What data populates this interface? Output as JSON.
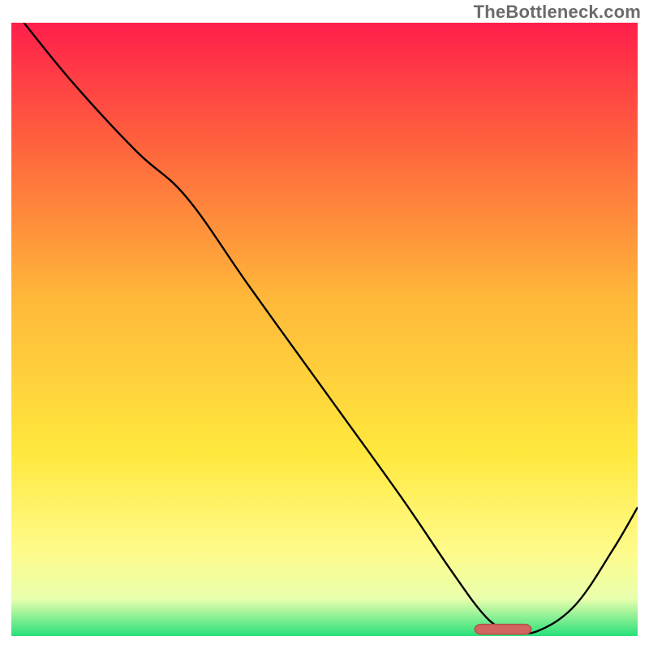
{
  "watermark": "TheBottleneck.com",
  "colors": {
    "gradient_top": "#ff1f4b",
    "gradient_mid1": "#ff6a3c",
    "gradient_mid2": "#ffb83a",
    "gradient_mid3": "#ffe83d",
    "gradient_mid4": "#fffb8a",
    "gradient_mid5": "#e8ffad",
    "gradient_bottom": "#28e07a",
    "line": "#000000",
    "marker_fill": "#d2655f",
    "marker_stroke": "#b84f49"
  },
  "chart_data": {
    "type": "line",
    "title": "",
    "xlabel": "",
    "ylabel": "",
    "xlim": [
      0,
      100
    ],
    "ylim": [
      0,
      100
    ],
    "series": [
      {
        "name": "bottleneck-curve",
        "x": [
          2,
          10,
          20,
          28,
          38,
          50,
          62,
          70,
          75,
          78,
          80,
          84,
          90,
          96,
          100
        ],
        "y": [
          100,
          90,
          79,
          71.5,
          57,
          40,
          23,
          11,
          4,
          1.3,
          0.8,
          0.8,
          5,
          14,
          21
        ]
      }
    ],
    "marker": {
      "name": "optimal-range",
      "x_start": 74,
      "x_end": 83,
      "y": 1.1,
      "height": 1.6,
      "rx": 1.0
    }
  }
}
